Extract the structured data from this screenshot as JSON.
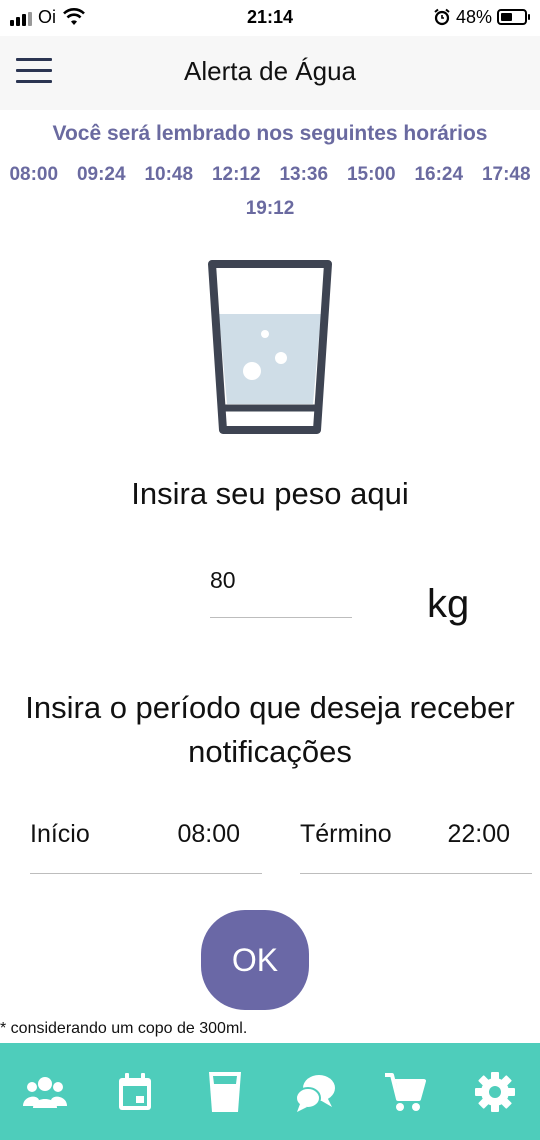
{
  "status_bar": {
    "carrier": "Oi",
    "time": "21:14",
    "battery": "48%",
    "icons": [
      "signal-icon",
      "wifi-icon",
      "alarm-icon",
      "battery-icon"
    ]
  },
  "header": {
    "title": "Alerta de Água",
    "menu_icon": "hamburger-menu-icon"
  },
  "reminders": {
    "title": "Você será lembrado nos seguintes horários",
    "times": [
      "08:00",
      "09:24",
      "10:48",
      "12:12",
      "13:36",
      "15:00",
      "16:24",
      "17:48",
      "19:12"
    ]
  },
  "weight": {
    "label": "Insira seu peso aqui",
    "value": "80",
    "unit": "kg"
  },
  "period": {
    "label": "Insira o período que deseja receber notificações",
    "start_label": "Início",
    "start_value": "08:00",
    "end_label": "Término",
    "end_value": "22:00"
  },
  "ok_button": "OK",
  "note": "* considerando um copo de 300ml.",
  "tabbar": {
    "items": [
      "users-icon",
      "calendar-icon",
      "water-glass-icon",
      "chat-icon",
      "cart-icon",
      "gear-icon"
    ]
  },
  "colors": {
    "accent": "#6a68a6",
    "tabbar": "#4ecdbb",
    "reminder_text": "#6a6aa0",
    "header_bg": "#f7f7f7"
  }
}
